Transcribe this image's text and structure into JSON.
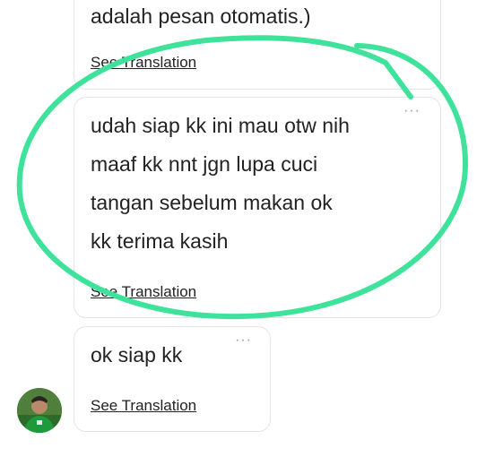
{
  "messages": [
    {
      "lines": [
        "adalah pesan otomatis.)"
      ],
      "translation_link": "See Translation"
    },
    {
      "lines": [
        "udah siap kk ini mau otw nih",
        "maaf kk nnt jgn lupa cuci",
        "tangan sebelum makan ok",
        "kk terima kasih"
      ],
      "translation_link": "See Translation",
      "more_icon": "more-options-icon"
    },
    {
      "lines": [
        "ok siap kk"
      ],
      "translation_link": "See Translation",
      "more_icon": "more-options-icon"
    }
  ],
  "annotation": {
    "color": "#3fe29a",
    "shape": "hand-drawn-ellipse"
  },
  "colors": {
    "text": "#222222",
    "bubble_border": "#e3e3e3",
    "avatar_bg": "#3d6b2d"
  }
}
